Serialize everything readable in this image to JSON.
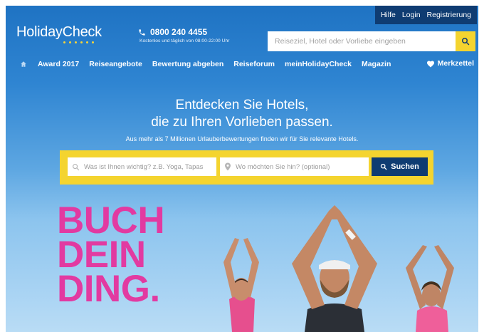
{
  "util_links": {
    "help": "Hilfe",
    "login": "Login",
    "register": "Registrierung"
  },
  "brand": {
    "name": "HolidayCheck",
    "accent": "#f4d42f",
    "nav_dark": "#0f3c72",
    "promo_pink": "#e23aa1"
  },
  "contact": {
    "phone": "0800 240 4455",
    "hours": "Kostenlos und täglich von 08:00-22:00 Uhr"
  },
  "top_search": {
    "placeholder": "Reiseziel, Hotel oder Vorliebe eingeben",
    "icon": "search-icon"
  },
  "nav": {
    "items": [
      "Award 2017",
      "Reiseangebote",
      "Bewertung abgeben",
      "Reiseforum",
      "meinHolidayCheck",
      "Magazin"
    ],
    "favorites": "Merkzettel"
  },
  "hero": {
    "line1": "Entdecken Sie Hotels,",
    "line2": "die zu Ihren Vorlieben passen.",
    "subtitle": "Aus mehr als 7 Millionen Urlauberbewertungen finden wir für Sie relevante Hotels.",
    "search": {
      "interest_placeholder": "Was ist Ihnen wichtig? z.B. Yoga, Tapas",
      "destination_placeholder": "Wo möchten Sie hin? (optional)",
      "button": "Suchen"
    }
  },
  "promo": {
    "line1": "BUCH",
    "line2": "DEIN",
    "line3": "DING."
  }
}
